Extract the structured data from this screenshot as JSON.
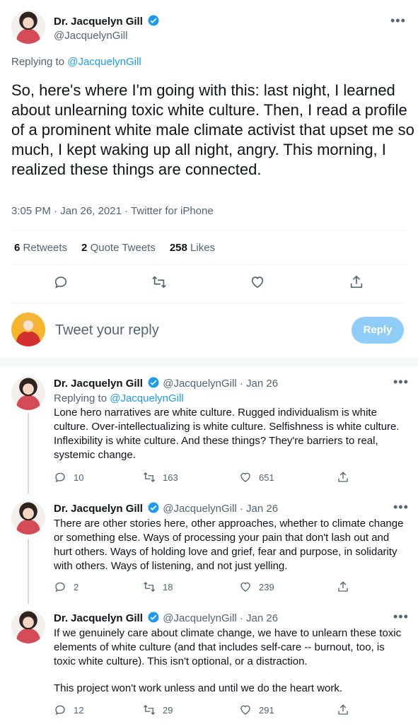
{
  "main_tweet": {
    "author": {
      "name": "Dr. Jacquelyn Gill",
      "handle": "@JacquelynGill"
    },
    "replying_label": "Replying to",
    "replying_to": "@JacquelynGill",
    "text": "So, here's where I'm going with this: last night, I learned about unlearning toxic white culture. Then, I read a profile of a prominent white male climate activist that upset me so much, I kept waking up all night, angry. This morning, I realized these things are connected.",
    "meta": "3:05 PM · Jan 26, 2021 · Twitter for iPhone",
    "stats": {
      "retweets_count": "6",
      "retweets_label": "Retweets",
      "quotes_count": "2",
      "quotes_label": "Quote Tweets",
      "likes_count": "258",
      "likes_label": "Likes"
    },
    "actions": {
      "reply_icon": "reply-icon",
      "retweet_icon": "retweet-icon",
      "like_icon": "heart-icon",
      "share_icon": "share-icon"
    }
  },
  "composer": {
    "placeholder": "Tweet your reply",
    "button_label": "Reply"
  },
  "replies": [
    {
      "name": "Dr. Jacquelyn Gill",
      "handle": "@JacquelynGill",
      "date": "· Jan 26",
      "replying_label": "Replying to",
      "replying_to": "@JacquelynGill",
      "text": "Lone hero narratives are white culture. Rugged individualism is white culture. Over-intellectualizing is white culture. Selfishness is white culture. Inflexibility is white culture. And these things? They're barriers to real, systemic change.",
      "replies": "10",
      "retweets": "163",
      "likes": "651"
    },
    {
      "name": "Dr. Jacquelyn Gill",
      "handle": "@JacquelynGill",
      "date": "· Jan 26",
      "text": "There are other stories here, other approaches, whether to climate change or something else. Ways of processing your pain that don't lash out and hurt others. Ways of holding love and grief, fear and purpose, in solidarity with others. Ways of listening, and not just yelling.",
      "replies": "2",
      "retweets": "18",
      "likes": "239"
    },
    {
      "name": "Dr. Jacquelyn Gill",
      "handle": "@JacquelynGill",
      "date": "· Jan 26",
      "text": "If we genuinely care about climate change, we have to unlearn these toxic elements of white culture (and that includes self-care -- burnout, too, is toxic white culture). This isn't optional, or a distraction.",
      "text2": "This project won't work unless and until we do the heart work.",
      "replies": "12",
      "retweets": "29",
      "likes": "291"
    }
  ],
  "colors": {
    "accent": "#1d9bf0",
    "muted": "#536471",
    "reply_button_disabled": "#8ecdf8"
  }
}
